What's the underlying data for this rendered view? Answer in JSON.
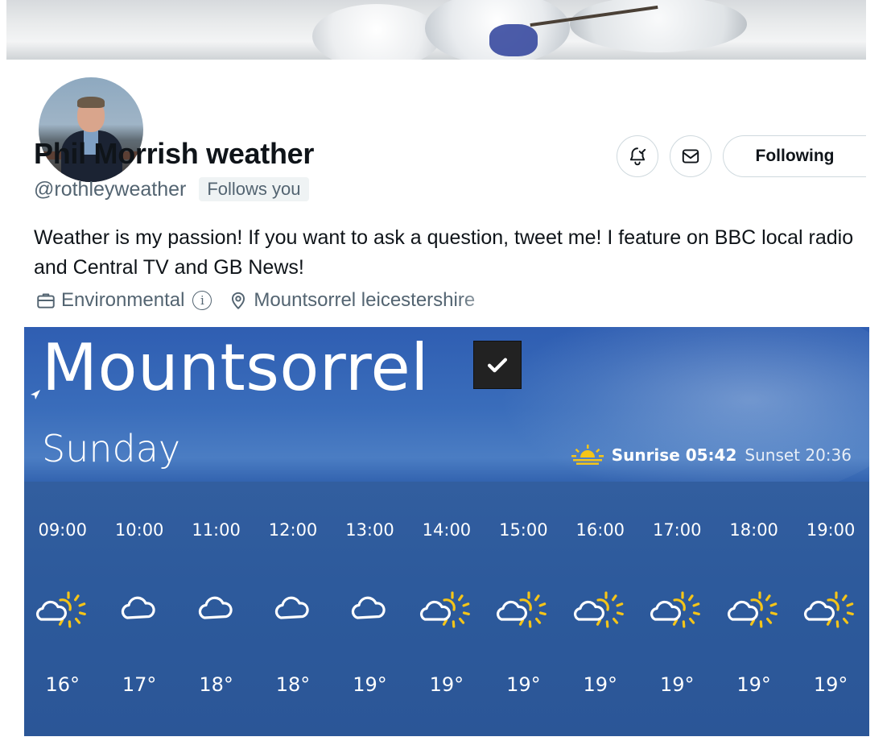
{
  "profile": {
    "display_name": "Phil Morrish weather",
    "handle": "@rothleyweather",
    "follows_you": "Follows you",
    "bio": "Weather is my passion! If you want to ask a question, tweet me! I feature on BBC local radio and Central TV and GB News!",
    "category": "Environmental",
    "location": "Mountsorrel leicestershire",
    "following_label": "Following",
    "icons": {
      "notifications": "bell-check-icon",
      "message": "envelope-icon",
      "category": "briefcase-icon",
      "info": "info-icon",
      "location": "location-pin-icon"
    }
  },
  "weather": {
    "location": "Mountsorrel",
    "day": "Sunday",
    "sunrise_label": "Sunrise 05:42",
    "sunset_label": "Sunset 20:36",
    "colors": {
      "sun": "#f5c518",
      "cloud_outline": "#ffffff",
      "panel": "#2c5aa3"
    },
    "hours": [
      {
        "time": "09:00",
        "icon": "sun-cloud-icon",
        "temp": "16°"
      },
      {
        "time": "10:00",
        "icon": "cloud-icon",
        "temp": "17°"
      },
      {
        "time": "11:00",
        "icon": "cloud-icon",
        "temp": "18°"
      },
      {
        "time": "12:00",
        "icon": "cloud-icon",
        "temp": "18°"
      },
      {
        "time": "13:00",
        "icon": "cloud-icon",
        "temp": "19°"
      },
      {
        "time": "14:00",
        "icon": "sun-cloud-icon",
        "temp": "19°"
      },
      {
        "time": "15:00",
        "icon": "sun-cloud-icon",
        "temp": "19°"
      },
      {
        "time": "16:00",
        "icon": "sun-cloud-icon",
        "temp": "19°"
      },
      {
        "time": "17:00",
        "icon": "sun-cloud-icon",
        "temp": "19°"
      },
      {
        "time": "18:00",
        "icon": "sun-cloud-icon",
        "temp": "19°"
      },
      {
        "time": "19:00",
        "icon": "sun-cloud-icon",
        "temp": "19°"
      }
    ]
  }
}
